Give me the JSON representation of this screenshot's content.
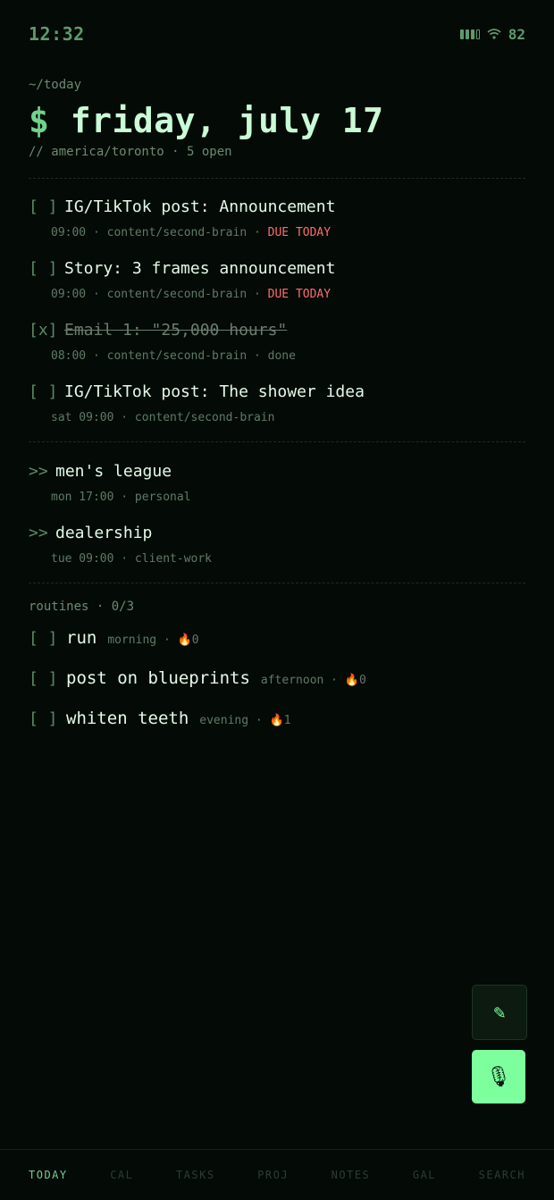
{
  "status": {
    "time": "12:32",
    "battery": "82",
    "signal_icon": "signal-icon",
    "wifi_icon": "wifi-icon"
  },
  "header": {
    "path": "~/today",
    "prompt": "$",
    "date": "friday, july 17",
    "subline": "// america/toronto · 5 open"
  },
  "tasks": [
    {
      "checkbox": "[ ]",
      "title": "IG/TikTok post: Announcement",
      "meta": "09:00 · content/second-brain · ",
      "due": "DUE TODAY",
      "done": false
    },
    {
      "checkbox": "[ ]",
      "title": "Story: 3 frames announcement",
      "meta": "09:00 · content/second-brain · ",
      "due": "DUE TODAY",
      "done": false
    },
    {
      "checkbox": "[x]",
      "title": "Email 1: \"25,000 hours\"",
      "meta": "08:00 · content/second-brain · done",
      "due": "",
      "done": true
    },
    {
      "checkbox": "[ ]",
      "title": "IG/TikTok post: The shower idea",
      "meta": "sat 09:00 · content/second-brain",
      "due": "",
      "done": false
    }
  ],
  "projects": [
    {
      "arrow": ">>",
      "title": "men's league",
      "meta": "mon 17:00 · personal"
    },
    {
      "arrow": ">>",
      "title": "dealership",
      "meta": "tue 09:00 · client-work"
    }
  ],
  "routines": {
    "header": "routines · 0/3",
    "items": [
      {
        "checkbox": "[ ]",
        "title": "run",
        "meta": "morning · 🔥0"
      },
      {
        "checkbox": "[ ]",
        "title": "post on blueprints",
        "meta": "afternoon · 🔥0"
      },
      {
        "checkbox": "[ ]",
        "title": "whiten teeth",
        "meta": "evening · 🔥1"
      }
    ]
  },
  "fabs": {
    "edit_icon": "✎",
    "mic_icon": "🎙"
  },
  "tabs": [
    "TODAY",
    "CAL",
    "TASKS",
    "PROJ",
    "NOTES",
    "GAL",
    "SEARCH"
  ],
  "colors": {
    "accent": "#7dff9e",
    "due": "#ff6b6b",
    "background": "#040a06"
  }
}
